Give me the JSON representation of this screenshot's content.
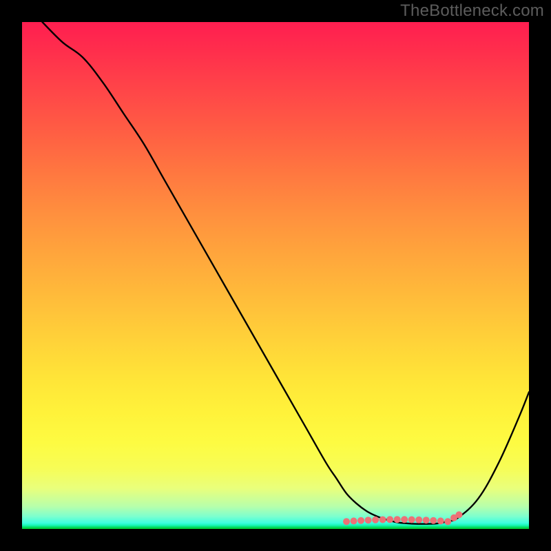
{
  "watermark": "TheBottleneck.com",
  "gradient": {
    "top_color": "#ff1e50",
    "bottom_color": "#00c62a"
  },
  "chart_data": {
    "type": "line",
    "title": "",
    "xlabel": "",
    "ylabel": "",
    "xlim": [
      0,
      100
    ],
    "ylim": [
      0,
      100
    ],
    "note": "Axes are not labeled in the image; x/y are normalized to 0-100 over the plot area. y=100 is the top, y=0 is the bottom (green). Values estimated from curve position against the gradient.",
    "series": [
      {
        "name": "bottleneck-curve",
        "x": [
          4,
          8,
          12,
          16,
          20,
          24,
          28,
          32,
          36,
          40,
          44,
          48,
          52,
          56,
          60,
          62,
          64,
          66,
          68,
          70,
          72,
          74,
          76,
          78,
          80,
          82,
          84,
          86,
          90,
          94,
          98,
          100
        ],
        "y": [
          100,
          96,
          93,
          88,
          82,
          76,
          69,
          62,
          55,
          48,
          41,
          34,
          27,
          20,
          13,
          10,
          7,
          5,
          3.5,
          2.5,
          1.8,
          1.3,
          1.1,
          1.0,
          1.0,
          1.1,
          1.5,
          2.2,
          6,
          13,
          22,
          27
        ]
      }
    ],
    "flat_markers": {
      "note": "Pink dotted segment near the valley floor",
      "color": "#ed7176",
      "x_range": [
        64,
        84
      ],
      "y_approx": 1.6,
      "dot_count": 15
    }
  }
}
